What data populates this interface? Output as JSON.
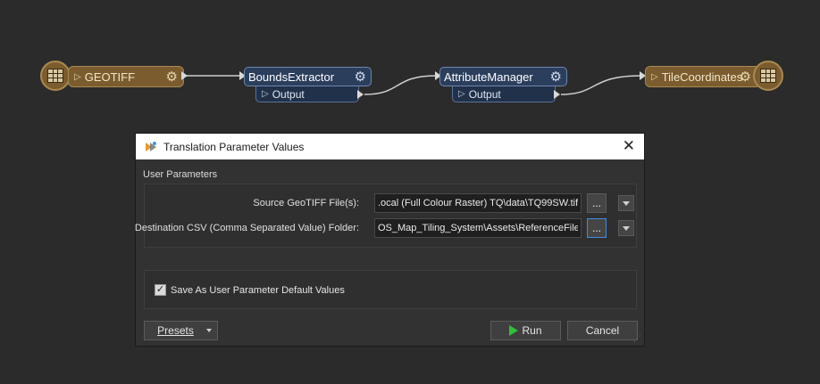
{
  "workspace": {
    "reader": {
      "name": "GEOTIFF",
      "icon": "raster-table-icon"
    },
    "transformers": [
      {
        "name": "BoundsExtractor",
        "output_port": "Output"
      },
      {
        "name": "AttributeManager",
        "output_port": "Output"
      }
    ],
    "writer": {
      "name": "TileCoordinates",
      "icon": "table-writer-icon"
    },
    "colors": {
      "feature_type": "#7a5c2f",
      "transformer": "#2b3e5c",
      "background": "#2b2b2b"
    }
  },
  "dialog": {
    "title": "Translation Parameter Values",
    "section_label": "User Parameters",
    "params": [
      {
        "label": "Source GeoTIFF File(s):",
        "value": ".ocal (Full Colour Raster) TQ\\data\\TQ99SW.tif\"",
        "browse": "...",
        "dropdown": "chevron-down-icon"
      },
      {
        "label": "Destination CSV (Comma Separated Value) Folder:",
        "value": "OS_Map_Tiling_System\\Assets\\ReferenceFiles\"",
        "browse": "...",
        "dropdown": "chevron-down-icon"
      }
    ],
    "save_default": {
      "label": "Save As User Parameter Default Values",
      "checked": true
    },
    "buttons": {
      "presets": "Presets",
      "run": "Run",
      "cancel": "Cancel"
    }
  }
}
